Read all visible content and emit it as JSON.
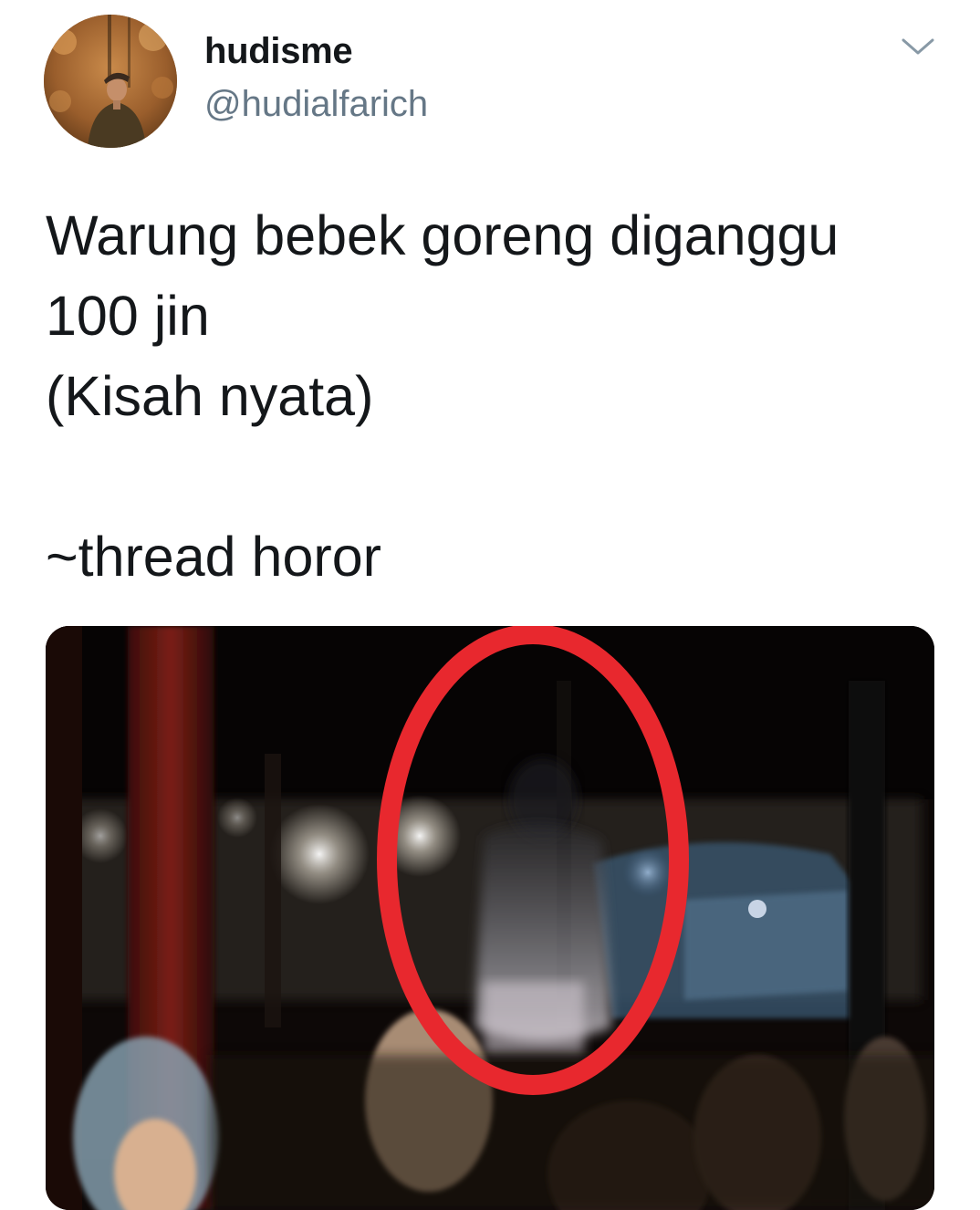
{
  "user": {
    "display_name": "hudisme",
    "handle": "@hudialfarich",
    "avatar_icon": "profile-photo"
  },
  "tweet": {
    "text": "Warung bebek goreng diganggu\n100 jin\n(Kisah nyata)\n\n~thread horor"
  },
  "menu": {
    "icon": "chevron-down-icon"
  },
  "colors": {
    "text": "#14171a",
    "muted": "#657786",
    "highlight_circle": "#e8282e"
  }
}
